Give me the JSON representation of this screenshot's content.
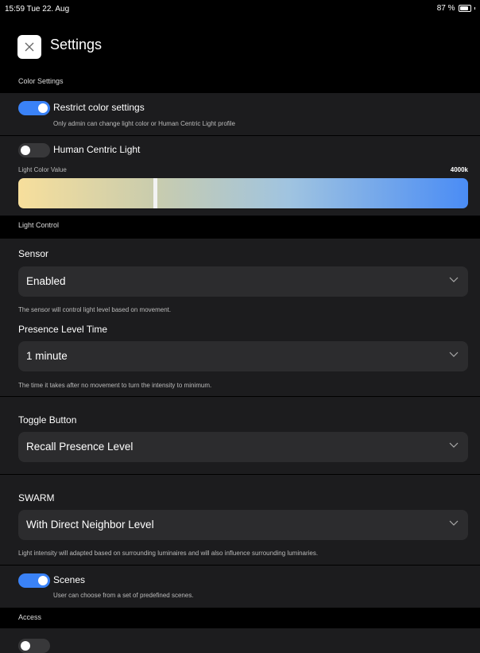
{
  "status_bar": {
    "time_date": "15:59 Tue 22. Aug",
    "battery": "87 %"
  },
  "header": {
    "close_icon": "close-icon",
    "title": "Settings"
  },
  "sections": {
    "color_settings": "Color Settings",
    "light_control": "Light Control",
    "access": "Access"
  },
  "color": {
    "restrict": {
      "label": "Restrict color settings",
      "enabled": true,
      "sub": "Only admin can change light color or Human Centric Light profile"
    },
    "hcl": {
      "label": "Human Centric Light",
      "enabled": false
    },
    "light_color_label": "Light Color Value",
    "light_color_value": "4000k",
    "slider_position": 0.3,
    "gradient_colors": [
      "#f7df9c",
      "#c9ccad",
      "#a0c4e0",
      "#4a8cf5"
    ]
  },
  "light_control": {
    "sensor": {
      "label": "Sensor",
      "value": "Enabled",
      "help": "The sensor will control light level based on movement."
    },
    "presence": {
      "label": "Presence Level Time",
      "value": "1 minute",
      "help": "The time it takes after no movement to turn the intensity to minimum."
    },
    "toggle_button": {
      "label": "Toggle Button",
      "value": "Recall Presence Level"
    },
    "swarm": {
      "label": "SWARM",
      "value": "With Direct Neighbor Level",
      "help": "Light intensity will adapted based on surrounding luminaires and will also influence surrounding luminaries."
    },
    "scenes": {
      "label": "Scenes",
      "enabled": true,
      "sub": "User can choose from a set of predefined scenes."
    }
  },
  "colors": {
    "accent": "#3a82f7",
    "background": "#1c1c1e",
    "section": "#000000",
    "field": "#2c2c2e"
  }
}
